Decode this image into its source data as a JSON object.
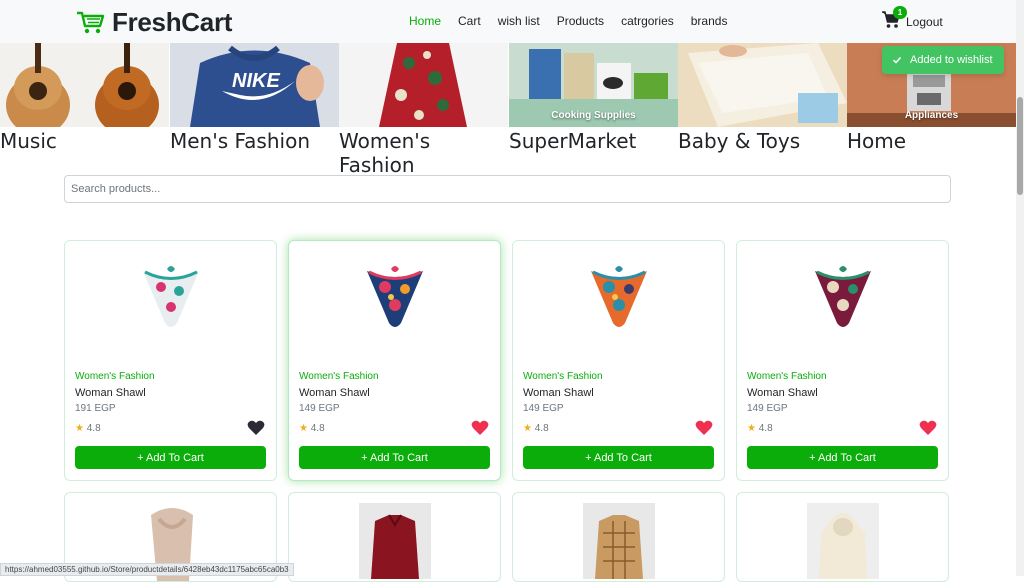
{
  "brand": {
    "name": "FreshCart"
  },
  "nav": {
    "links": [
      "Home",
      "Cart",
      "wish list",
      "Products",
      "catrgories",
      "brands"
    ],
    "active": "Home",
    "cart_count": "1",
    "logout_label": "Logout"
  },
  "toast": {
    "message": "Added to wishlist"
  },
  "categories": [
    {
      "label": "Music",
      "overlay": ""
    },
    {
      "label": "Men's Fashion",
      "overlay": ""
    },
    {
      "label": "Women's Fashion",
      "overlay": ""
    },
    {
      "label": "SuperMarket",
      "overlay": "Cooking Supplies"
    },
    {
      "label": "Baby & Toys",
      "overlay": ""
    },
    {
      "label": "Home",
      "overlay": "Appliances"
    }
  ],
  "search": {
    "placeholder": "Search products..."
  },
  "products": [
    {
      "category": "Women's Fashion",
      "title": "Woman Shawl",
      "price": "191 EGP",
      "rating": "4.8",
      "wishlisted": false
    },
    {
      "category": "Women's Fashion",
      "title": "Woman Shawl",
      "price": "149 EGP",
      "rating": "4.8",
      "wishlisted": true
    },
    {
      "category": "Women's Fashion",
      "title": "Woman Shawl",
      "price": "149 EGP",
      "rating": "4.8",
      "wishlisted": true
    },
    {
      "category": "Women's Fashion",
      "title": "Woman Shawl",
      "price": "149 EGP",
      "rating": "4.8",
      "wishlisted": true
    }
  ],
  "add_to_cart_label": "+ Add To Cart",
  "status_url": "https://ahmed03555.github.io/Store/productdetails/6428eb43dc1175abc65ca0b3",
  "colors": {
    "accent": "#0aad0a",
    "heart_active": "#f0304f",
    "heart_inactive": "#2b2b36",
    "star": "#f0ad1e"
  }
}
